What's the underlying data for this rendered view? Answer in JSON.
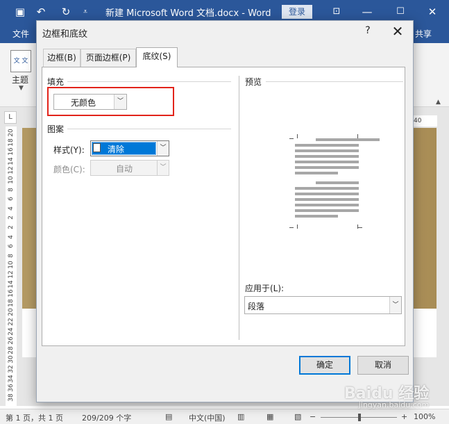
{
  "word": {
    "doc_title": "新建 Microsoft Word 文档.docx  -  Word",
    "login_label": "登录",
    "file_tab": "文件",
    "share_tab": "共享",
    "theme_icon_text": "文 文",
    "theme_label": "主题",
    "ruler_corner": "L",
    "hruler_number": "40",
    "vruler_numbers": [
      "20",
      "18",
      "16",
      "14",
      "12",
      "10",
      "8",
      "6",
      "4",
      "2",
      "2",
      "4",
      "6",
      "8",
      "10",
      "12",
      "14",
      "16",
      "18",
      "20",
      "22",
      "24",
      "26",
      "28",
      "30",
      "32",
      "34",
      "36",
      "38"
    ],
    "status": {
      "page": "第 1 页，共 1 页",
      "words": "209/209 个字",
      "language": "中文(中国)",
      "zoom": "100%"
    }
  },
  "dialog": {
    "title": "边框和底纹",
    "help_label": "?",
    "close_label": "✕",
    "tabs": [
      {
        "label": "边框(B)",
        "active": false
      },
      {
        "label": "页面边框(P)",
        "active": false
      },
      {
        "label": "底纹(S)",
        "active": true
      }
    ],
    "fill": {
      "section_label": "填充",
      "value": "无颜色"
    },
    "pattern": {
      "section_label": "图案",
      "style_label": "样式(Y):",
      "style_value": "清除",
      "color_label": "颜色(C):",
      "color_value": "自动"
    },
    "preview": {
      "section_label": "预览"
    },
    "apply": {
      "label": "应用于(L):",
      "value": "段落"
    },
    "ok_label": "确定",
    "cancel_label": "取消"
  },
  "watermark": {
    "text": "Baidu 经验",
    "subtext": "jingyan.baidu.com"
  },
  "colors": {
    "word_blue": "#2b579a",
    "highlight_red": "#e2231a",
    "selection_blue": "#0078d7"
  }
}
